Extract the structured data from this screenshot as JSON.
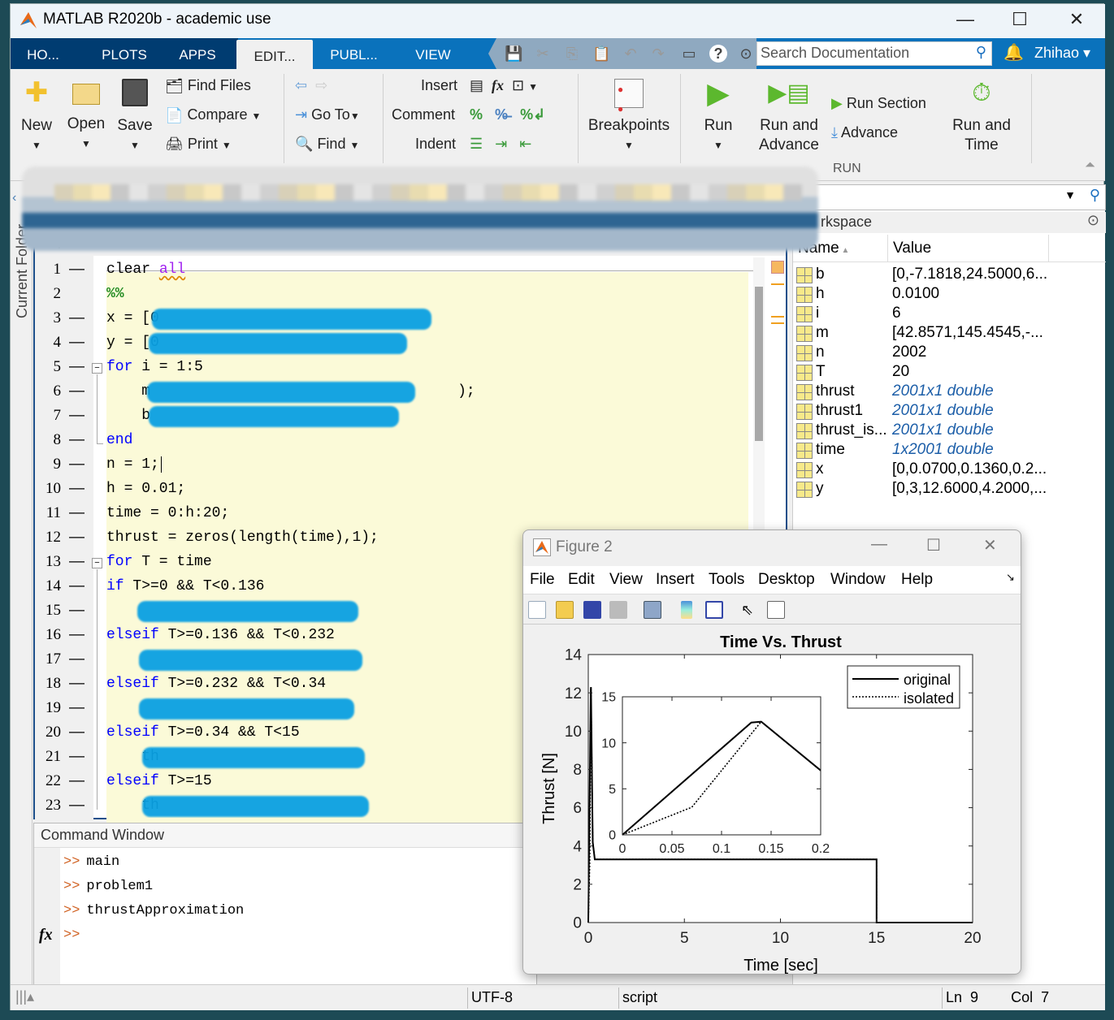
{
  "app": {
    "title": "MATLAB R2020b - academic use",
    "minimize": "—",
    "maximize": "☐",
    "close": "✕"
  },
  "tabs": [
    {
      "label": "HO..."
    },
    {
      "label": "PLOTS"
    },
    {
      "label": "APPS"
    },
    {
      "label": "EDIT..."
    },
    {
      "label": "PUBL..."
    },
    {
      "label": "VIEW"
    }
  ],
  "search": {
    "placeholder": "Search Documentation"
  },
  "user": {
    "name": "Zhihao"
  },
  "ribbon": {
    "new": "New",
    "open": "Open",
    "save": "Save",
    "find_files": "Find Files",
    "compare": "Compare",
    "print": "Print",
    "go_to": "Go To",
    "find": "Find",
    "insert": "Insert",
    "comment": "Comment",
    "indent": "Indent",
    "breakpoints": "Breakpoints",
    "run": "Run",
    "run_and_advance_1": "Run and",
    "run_and_advance_2": "Advance",
    "run_section": "Run Section",
    "advance": "Advance",
    "run_and_time_1": "Run and",
    "run_and_time_2": "Time",
    "run_group": "RUN"
  },
  "sidebar": {
    "current_folder": "Current Folder"
  },
  "editor": {
    "lines": [
      {
        "n": "1",
        "parts": [
          [
            "",
            "clear "
          ],
          [
            "str",
            "all"
          ]
        ]
      },
      {
        "n": "2",
        "parts": [
          [
            "sec",
            "%%"
          ]
        ],
        "nodash": true
      },
      {
        "n": "3",
        "parts": [
          [
            "",
            "x = [0"
          ]
        ],
        "redact": [
          56,
          400
        ]
      },
      {
        "n": "4",
        "parts": [
          [
            "",
            "y = [0"
          ]
        ],
        "redact": [
          52,
          370
        ]
      },
      {
        "n": "5",
        "parts": [
          [
            "kw",
            "for"
          ],
          [
            "",
            " i = 1:5"
          ]
        ],
        "fold": "start"
      },
      {
        "n": "6",
        "parts": [
          [
            "",
            "    m"
          ],
          [
            "",
            " ",
            ""
          ],
          [
            "",
            "                                  );"
          ]
        ],
        "redact": [
          50,
          380
        ]
      },
      {
        "n": "7",
        "parts": [
          [
            "",
            "    b"
          ]
        ],
        "redact": [
          52,
          360
        ]
      },
      {
        "n": "8",
        "parts": [
          [
            "kw",
            "end"
          ]
        ],
        "fold": "end"
      },
      {
        "n": "9",
        "parts": [
          [
            "",
            "n = 1;"
          ]
        ],
        "cursor": true
      },
      {
        "n": "10",
        "parts": [
          [
            "",
            "h = 0.01;"
          ]
        ]
      },
      {
        "n": "11",
        "parts": [
          [
            "",
            "time = 0:h:20;"
          ]
        ]
      },
      {
        "n": "12",
        "parts": [
          [
            "",
            "thrust = zeros(length(time),1);"
          ]
        ]
      },
      {
        "n": "13",
        "parts": [
          [
            "kw",
            "for"
          ],
          [
            "",
            " T = time"
          ]
        ],
        "fold": "start"
      },
      {
        "n": "14",
        "parts": [
          [
            "kw",
            "if"
          ],
          [
            "",
            " T>=0 && T<0.136"
          ]
        ]
      },
      {
        "n": "15",
        "parts": [
          [
            "",
            ""
          ]
        ],
        "redact": [
          38,
          310
        ]
      },
      {
        "n": "16",
        "parts": [
          [
            "kw",
            "elseif"
          ],
          [
            "",
            " T>=0.136 && T<0.232"
          ]
        ]
      },
      {
        "n": "17",
        "parts": [
          [
            "",
            ""
          ]
        ],
        "redact": [
          40,
          315
        ]
      },
      {
        "n": "18",
        "parts": [
          [
            "kw",
            "elseif"
          ],
          [
            "",
            " T>=0.232 && T<0.34"
          ]
        ]
      },
      {
        "n": "19",
        "parts": [
          [
            "",
            ""
          ]
        ],
        "redact": [
          40,
          305
        ]
      },
      {
        "n": "20",
        "parts": [
          [
            "kw",
            "elseif"
          ],
          [
            "",
            " T>=0.34 && T<15"
          ]
        ]
      },
      {
        "n": "21",
        "parts": [
          [
            "",
            "    th"
          ]
        ],
        "redact": [
          44,
          318
        ]
      },
      {
        "n": "22",
        "parts": [
          [
            "kw",
            "elseif"
          ],
          [
            "",
            " T>=15"
          ]
        ]
      },
      {
        "n": "23",
        "parts": [
          [
            "",
            "    th"
          ]
        ],
        "redact": [
          44,
          323
        ]
      }
    ]
  },
  "workspace": {
    "title": "Workspace",
    "visible_title": "rkspace",
    "col_name": "Name",
    "col_value": "Value",
    "rows": [
      {
        "name": "b",
        "value": "[0,-7.1818,24.5000,6..."
      },
      {
        "name": "h",
        "value": "0.0100"
      },
      {
        "name": "i",
        "value": "6"
      },
      {
        "name": "m",
        "value": "[42.8571,145.4545,-..."
      },
      {
        "name": "n",
        "value": "2002"
      },
      {
        "name": "T",
        "value": "20"
      },
      {
        "name": "thrust",
        "value": "2001x1 double",
        "italic": true
      },
      {
        "name": "thrust1",
        "value": "2001x1 double",
        "italic": true
      },
      {
        "name": "thrust_is...",
        "value": "2001x1 double",
        "italic": true
      },
      {
        "name": "time",
        "value": "1x2001 double",
        "italic": true
      },
      {
        "name": "x",
        "value": "[0,0.0700,0.1360,0.2..."
      },
      {
        "name": "y",
        "value": "[0,3,12.6000,4.2000,..."
      }
    ]
  },
  "command_window": {
    "title": "Command Window",
    "prompt": ">>",
    "history": [
      "main",
      "problem1",
      "thrustApproximation"
    ],
    "fx": "fx"
  },
  "status": {
    "encoding": "UTF-8",
    "type": "script",
    "ln_label": "Ln",
    "ln": "9",
    "col_label": "Col",
    "col": "7"
  },
  "figure": {
    "title": "Figure 2",
    "menu": [
      "File",
      "Edit",
      "View",
      "Insert",
      "Tools",
      "Desktop",
      "Window",
      "Help"
    ]
  },
  "chart_data": [
    {
      "type": "line",
      "title": "Time Vs. Thrust",
      "xlabel": "Time [sec]",
      "ylabel": "Thrust [N]",
      "xlim": [
        0,
        20
      ],
      "ylim": [
        0,
        14
      ],
      "xticks": [
        0,
        5,
        10,
        15,
        20
      ],
      "yticks": [
        0,
        2,
        4,
        6,
        8,
        10,
        12,
        14
      ],
      "legend": "top-right",
      "grid": false,
      "series": [
        {
          "name": "original",
          "style": "solid",
          "x": [
            0,
            0.13,
            0.14,
            0.2,
            0.232,
            0.34,
            15,
            15,
            20
          ],
          "y": [
            0,
            12.2,
            12.3,
            7,
            4.2,
            3.3,
            3.3,
            0,
            0
          ]
        },
        {
          "name": "isolated",
          "style": "dotted",
          "x": [
            0,
            0.07,
            0.14,
            0.2,
            0.232,
            0.34,
            15,
            15,
            20
          ],
          "y": [
            0,
            3,
            12.3,
            7,
            4.2,
            3.3,
            3.3,
            0,
            0
          ]
        }
      ]
    },
    {
      "type": "line",
      "inset": true,
      "xlim": [
        0,
        0.2
      ],
      "ylim": [
        0,
        15
      ],
      "xticks": [
        0,
        0.05,
        0.1,
        0.15,
        0.2
      ],
      "yticks": [
        0,
        5,
        10,
        15
      ],
      "grid": false,
      "series": [
        {
          "style": "solid",
          "x": [
            0,
            0.13,
            0.14,
            0.2
          ],
          "y": [
            0,
            12.2,
            12.3,
            7
          ]
        },
        {
          "style": "dotted",
          "x": [
            0,
            0.07,
            0.14,
            0.2
          ],
          "y": [
            0,
            3,
            12.3,
            7
          ]
        }
      ]
    }
  ],
  "colors": {
    "accent": "#0a72bc",
    "dark_tab": "#003c71",
    "editor_bg": "#fbfad8",
    "keyword": "#0000ff",
    "string": "#a020f0",
    "section": "#228b22",
    "redaction": "#0aa0e2"
  }
}
